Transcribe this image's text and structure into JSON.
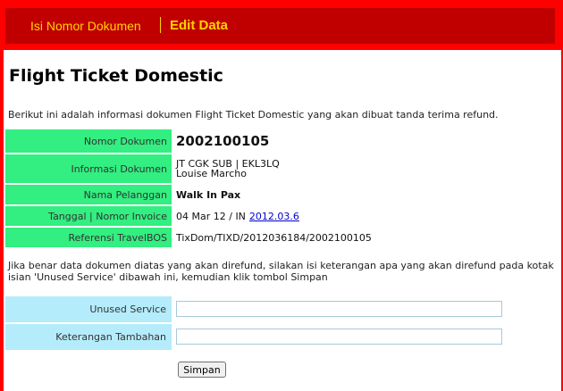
{
  "nav": {
    "items": [
      {
        "label": "Isi Nomor Dokumen"
      },
      {
        "label": "Edit Data"
      }
    ]
  },
  "page": {
    "title": "Flight Ticket Domestic",
    "intro": "Berikut ini adalah informasi dokumen Flight Ticket Domestic yang akan dibuat tanda terima refund.",
    "note": "Jika benar data dokumen diatas yang akan direfund, silakan isi keterangan apa yang akan direfund pada kotak isian 'Unused Service' dibawah ini, kemudian klik tombol Simpan"
  },
  "info": {
    "nomor_dokumen": {
      "label": "Nomor Dokumen",
      "value": "2002100105"
    },
    "informasi_dokumen": {
      "label": "Informasi Dokumen",
      "line1": "JT CGK SUB | EKL3LQ",
      "line2": "Louise Marcho"
    },
    "nama_pelanggan": {
      "label": "Nama Pelanggan",
      "value": "Walk In Pax"
    },
    "tanggal_invoice": {
      "label": "Tanggal | Nomor Invoice",
      "value": "04 Mar 12 / IN",
      "link": "2012.03.6"
    },
    "referensi": {
      "label": "Referensi TravelBOS",
      "value": "TixDom/TIXD/2012036184/2002100105"
    }
  },
  "form": {
    "unused_service": {
      "label": "Unused Service",
      "value": ""
    },
    "keterangan": {
      "label": "Keterangan Tambahan",
      "value": ""
    },
    "submit_label": "Simpan"
  },
  "colors": {
    "frame": "#ff0000",
    "nav_bg": "#c00000",
    "nav_text": "#ffd400",
    "info_label_bg": "#33ee80",
    "form_label_bg": "#b5ecfb"
  }
}
